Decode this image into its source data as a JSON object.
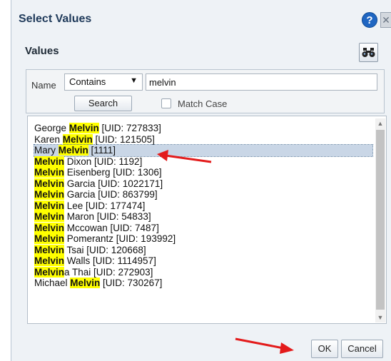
{
  "dialog": {
    "title": "Select Values",
    "help_icon": "help-icon",
    "close_icon": "close-icon",
    "help_glyph": "?",
    "close_glyph": "✕"
  },
  "values_section": {
    "title": "Values",
    "search_icon": "binoculars-icon"
  },
  "search": {
    "name_label": "Name",
    "operator_selected": "Contains",
    "query_value": "melvin",
    "search_button": "Search",
    "match_case_label": "Match Case",
    "match_case_checked": false
  },
  "results": {
    "selected_index": 2,
    "items": [
      {
        "pre": "George ",
        "hl": "Melvin",
        "post": " [UID: 727833]"
      },
      {
        "pre": "Karen ",
        "hl": "Melvin",
        "post": " [UID: 121505]"
      },
      {
        "pre": "Mary ",
        "hl": "Melvin",
        "post": " [1111]"
      },
      {
        "pre": "",
        "hl": "Melvin",
        "post": " Dixon [UID: 1192]"
      },
      {
        "pre": "",
        "hl": "Melvin",
        "post": " Eisenberg [UID: 1306]"
      },
      {
        "pre": "",
        "hl": "Melvin",
        "post": " Garcia [UID: 1022171]"
      },
      {
        "pre": "",
        "hl": "Melvin",
        "post": " Garcia [UID: 863799]"
      },
      {
        "pre": "",
        "hl": "Melvin",
        "post": " Lee [UID: 177474]"
      },
      {
        "pre": "",
        "hl": "Melvin",
        "post": " Maron [UID: 54833]"
      },
      {
        "pre": "",
        "hl": "Melvin",
        "post": " Mccowan [UID: 7487]"
      },
      {
        "pre": "",
        "hl": "Melvin",
        "post": " Pomerantz [UID: 193992]"
      },
      {
        "pre": "",
        "hl": "Melvin",
        "post": " Tsai [UID: 120668]"
      },
      {
        "pre": "",
        "hl": "Melvin",
        "post": " Walls [UID: 1114957]"
      },
      {
        "pre": "",
        "hl": "Melvin",
        "post": "a Thai [UID: 272903]"
      },
      {
        "pre": "Michael ",
        "hl": "Melvin",
        "post": " [UID: 730267]"
      }
    ]
  },
  "footer": {
    "ok_label": "OK",
    "cancel_label": "Cancel"
  },
  "colors": {
    "highlight": "#ffff00",
    "selection": "#c9d6e6",
    "annotation_arrow": "#e31b1b"
  }
}
